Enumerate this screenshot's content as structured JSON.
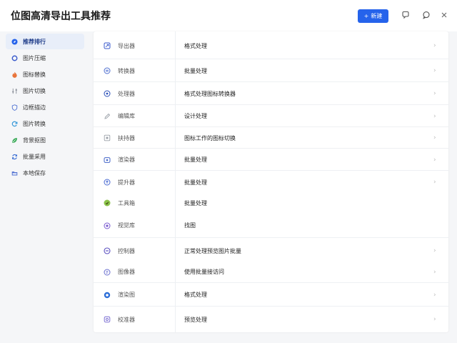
{
  "header": {
    "title": "位图高清导出工具推荐",
    "new_button": {
      "icon": "plus-icon",
      "label": "新建"
    },
    "icons": [
      "feedback-icon",
      "chat-icon",
      "close-icon"
    ]
  },
  "sidebar": {
    "items": [
      {
        "label": "推荐排行",
        "icon": "compass-icon",
        "color": "#2563eb",
        "active": true
      },
      {
        "label": "图片压缩",
        "icon": "dot-icon",
        "color": "#3b5bcc",
        "active": false
      },
      {
        "label": "图标替换",
        "icon": "flame-icon",
        "color": "#e8743b",
        "active": false
      },
      {
        "label": "图片切换",
        "icon": "sliders-icon",
        "color": "#8a8f99",
        "active": false
      },
      {
        "label": "边框描边",
        "icon": "shield-icon",
        "color": "#5b7bd5",
        "active": false
      },
      {
        "label": "图片转换",
        "icon": "refresh-icon",
        "color": "#3a9ad9",
        "active": false
      },
      {
        "label": "背景抠图",
        "icon": "leaf-icon",
        "color": "#34a853",
        "active": false
      },
      {
        "label": "批量采用",
        "icon": "sync-icon",
        "color": "#3b6fd4",
        "active": false
      },
      {
        "label": "本地保存",
        "icon": "folder-icon",
        "color": "#4f6fd0",
        "active": false
      }
    ]
  },
  "tools": [
    {
      "name": "导出器",
      "desc": "格式处理",
      "icon": "export-icon",
      "color": "#3b5bcc"
    },
    {
      "name": "转换器",
      "desc": "批量处理",
      "icon": "convert-icon",
      "color": "#4f6fd0"
    },
    {
      "name": "处理器",
      "desc": "格式处理图标转换器",
      "icon": "process-icon",
      "color": "#2a4fb8"
    },
    {
      "name": "编辑库",
      "desc": "设计处理",
      "icon": "edit-icon",
      "color": "#9aa0a8"
    },
    {
      "name": "扶持器",
      "desc": "图标工作的图标切换",
      "icon": "support-icon",
      "color": "#9aa0a8"
    },
    {
      "name": "渲染器",
      "desc": "批量处理",
      "icon": "render-icon",
      "color": "#4466c8"
    },
    {
      "name": "提升器",
      "desc": "批量处理",
      "icon": "enhance-icon",
      "color": "#4a6ad2"
    },
    {
      "name": "工具箱",
      "desc": "批量处理",
      "icon": "toolbox-icon",
      "color": "#8bc34a"
    },
    {
      "name": "视觉库",
      "desc": "找图",
      "icon": "vision-icon",
      "color": "#7a5bd0"
    },
    {
      "name": "控制器",
      "desc": "正常处理预览图片批量",
      "icon": "control-icon",
      "color": "#5a4fc0"
    },
    {
      "name": "图像器",
      "desc": "使用批量接访问",
      "icon": "image-icon",
      "color": "#6a6fcf"
    },
    {
      "name": "渲染图",
      "desc": "格式处理",
      "icon": "render-icon",
      "color": "#2e6fd8"
    },
    {
      "name": "校准器",
      "desc": "预览处理",
      "icon": "calibrate-icon",
      "color": "#7b6fd2"
    }
  ]
}
